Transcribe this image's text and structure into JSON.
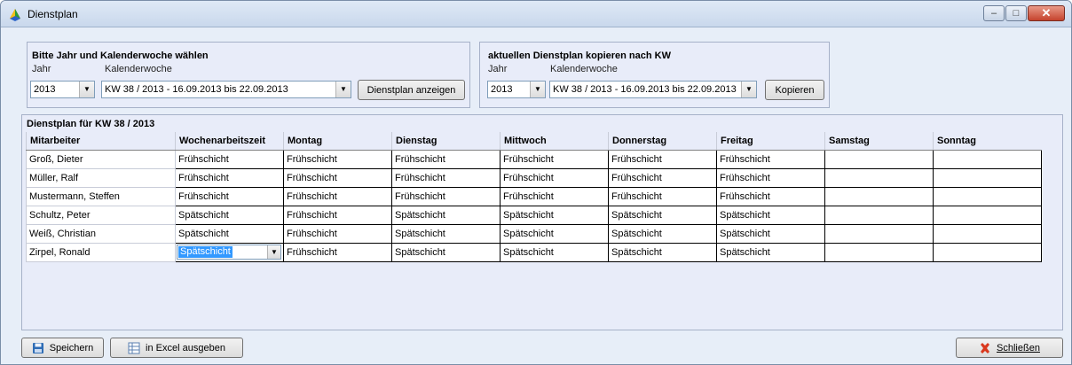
{
  "window": {
    "title": "Dienstplan",
    "controls": {
      "minimize": "–",
      "maximize": "□",
      "close": "✕"
    }
  },
  "select_group": {
    "title": "Bitte Jahr und Kalenderwoche wählen",
    "year_label": "Jahr",
    "week_label": "Kalenderwoche",
    "year_value": "2013",
    "week_value": "KW 38 / 2013 - 16.09.2013 bis 22.09.2013",
    "show_button": "Dienstplan anzeigen"
  },
  "copy_group": {
    "title": "aktuellen Dienstplan kopieren nach KW",
    "year_label": "Jahr",
    "week_label": "Kalenderwoche",
    "year_value": "2013",
    "week_value": "KW 38 / 2013 - 16.09.2013 bis 22.09.2013",
    "copy_button": "Kopieren"
  },
  "plan": {
    "title": "Dienstplan für KW 38 / 2013",
    "columns": [
      "Mitarbeiter",
      "Wochenarbeitszeit",
      "Montag",
      "Dienstag",
      "Mittwoch",
      "Donnerstag",
      "Freitag",
      "Samstag",
      "Sonntag"
    ],
    "rows": [
      {
        "name": "Groß, Dieter",
        "cells": [
          "Frühschicht",
          "Frühschicht",
          "Frühschicht",
          "Frühschicht",
          "Frühschicht",
          "Frühschicht",
          "",
          ""
        ]
      },
      {
        "name": "Müller, Ralf",
        "cells": [
          "Frühschicht",
          "Frühschicht",
          "Frühschicht",
          "Frühschicht",
          "Frühschicht",
          "Frühschicht",
          "",
          ""
        ]
      },
      {
        "name": "Mustermann, Steffen",
        "cells": [
          "Frühschicht",
          "Frühschicht",
          "Frühschicht",
          "Frühschicht",
          "Frühschicht",
          "Frühschicht",
          "",
          ""
        ]
      },
      {
        "name": "Schultz, Peter",
        "cells": [
          "Spätschicht",
          "Frühschicht",
          "Spätschicht",
          "Spätschicht",
          "Spätschicht",
          "Spätschicht",
          "",
          ""
        ]
      },
      {
        "name": "Weiß, Christian",
        "cells": [
          "Spätschicht",
          "Frühschicht",
          "Spätschicht",
          "Spätschicht",
          "Spätschicht",
          "Spätschicht",
          "",
          ""
        ]
      },
      {
        "name": "Zirpel, Ronald",
        "cells": [
          "Spätschicht",
          "Frühschicht",
          "Spätschicht",
          "Spätschicht",
          "Spätschicht",
          "Spätschicht",
          "",
          ""
        ]
      }
    ],
    "active_cell": {
      "row": 5,
      "col": 0
    }
  },
  "footer": {
    "save_button": "Speichern",
    "excel_button": "in Excel ausgeben",
    "close_button": "Schließen"
  },
  "colors": {
    "accent": "#3399ff",
    "panel": "#e8ecf9",
    "close_icon": "#d9381e",
    "save_icon": "#2f6db5"
  },
  "icons": {
    "app": "app-logo-icon",
    "save": "floppy-disk-icon",
    "excel": "spreadsheet-icon",
    "close": "red-x-icon"
  }
}
